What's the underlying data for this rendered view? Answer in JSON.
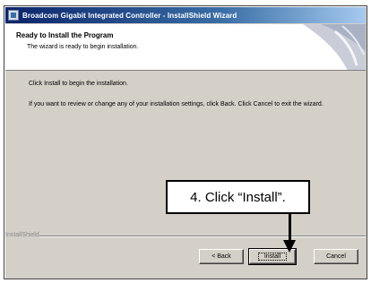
{
  "window": {
    "title": "Broadcom Gigabit Integrated Controller - InstallShield Wizard"
  },
  "header": {
    "title": "Ready to Install the Program",
    "subtitle": "The wizard is ready to begin installation."
  },
  "content": {
    "line1": "Click Install to begin the installation.",
    "line2": "If you want to review or change any of your installation settings, click Back. Click Cancel to exit the wizard."
  },
  "footer": {
    "brand": "InstallShield"
  },
  "buttons": {
    "back": "< Back",
    "install": "Install",
    "cancel": "Cancel"
  },
  "callout": {
    "text": "4. Click “Install”."
  },
  "colors": {
    "titlebar_start": "#0a246a",
    "titlebar_end": "#a6caf0",
    "dialog_face": "#d4d0c8"
  }
}
